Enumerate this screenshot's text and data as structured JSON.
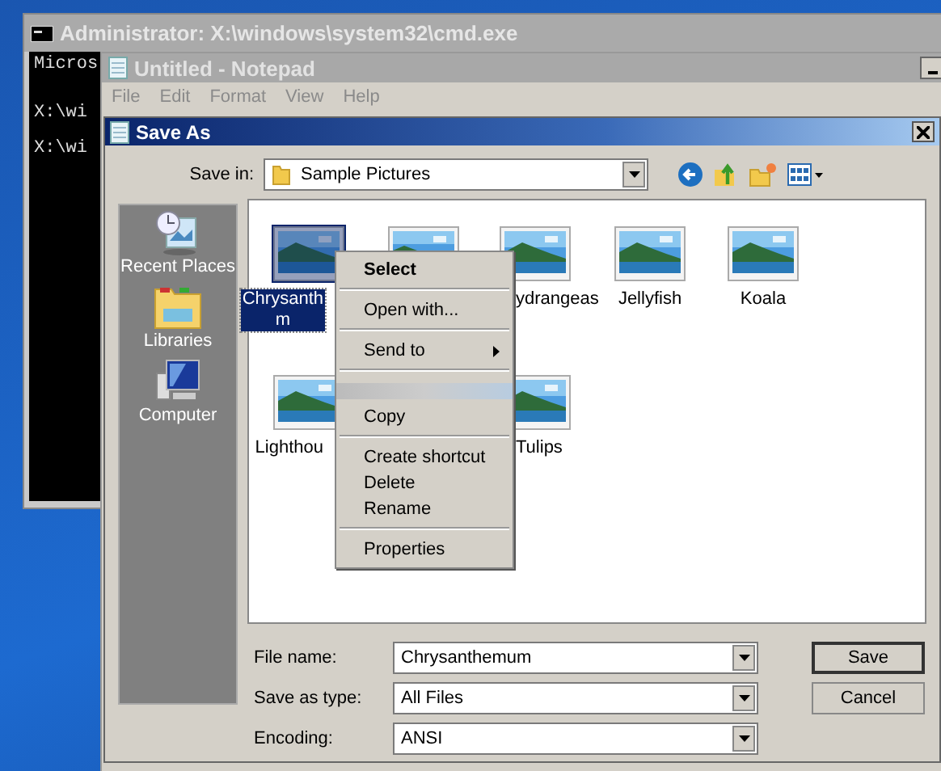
{
  "console_window": {
    "title": "Administrator: X:\\windows\\system32\\cmd.exe",
    "lines": [
      "Micros",
      "X:\\wi",
      "X:\\wi"
    ]
  },
  "notepad_window": {
    "title": "Untitled - Notepad",
    "menu": [
      "File",
      "Edit",
      "Format",
      "View",
      "Help"
    ]
  },
  "save_dialog": {
    "title": "Save As",
    "save_in": {
      "label": "Save in:",
      "value": "Sample Pictures"
    },
    "places": [
      {
        "kind": "recent",
        "label": "Recent Places"
      },
      {
        "kind": "libraries",
        "label": "Libraries"
      },
      {
        "kind": "computer",
        "label": "Computer"
      }
    ],
    "files": [
      {
        "kind": "file",
        "label_lines": [
          "Chrysanth",
          "m"
        ],
        "selected": true
      },
      {
        "kind": "partial",
        "selected": false
      },
      {
        "kind": "file",
        "label_lines": [
          "ydrangeas"
        ],
        "selected": false
      },
      {
        "kind": "file",
        "label_lines": [
          "Jellyfish"
        ],
        "selected": false
      },
      {
        "kind": "file",
        "label_lines": [
          "Koala"
        ],
        "selected": false
      },
      {
        "kind": "file",
        "label_lines": [
          "Lighthou"
        ],
        "selected": false
      },
      {
        "kind": "covered"
      },
      {
        "kind": "file",
        "label_lines": [
          "Tulips"
        ],
        "selected": false
      }
    ],
    "fields": [
      {
        "label": "File name:",
        "value": "Chrysanthemum"
      },
      {
        "label": "Save as type:",
        "value": "All Files"
      },
      {
        "label": "Encoding:",
        "value": "ANSI"
      }
    ],
    "buttons": [
      {
        "label": "Save",
        "default": true
      },
      {
        "label": "Cancel",
        "default": false
      }
    ]
  },
  "context_menu": [
    {
      "kind": "item",
      "label": "Select",
      "default": true,
      "submenu": false
    },
    {
      "kind": "separator"
    },
    {
      "kind": "item",
      "label": "Open with...",
      "default": false,
      "submenu": false
    },
    {
      "kind": "separator"
    },
    {
      "kind": "item",
      "label": "Send to",
      "default": false,
      "submenu": true
    },
    {
      "kind": "separator"
    },
    {
      "kind": "blurred"
    },
    {
      "kind": "item",
      "label": "Copy",
      "default": false,
      "submenu": false
    },
    {
      "kind": "separator"
    },
    {
      "kind": "item",
      "label": "Create shortcut",
      "default": false,
      "submenu": false
    },
    {
      "kind": "item",
      "label": "Delete",
      "default": false,
      "submenu": false
    },
    {
      "kind": "item",
      "label": "Rename",
      "default": false,
      "submenu": false
    },
    {
      "kind": "separator"
    },
    {
      "kind": "item",
      "label": "Properties",
      "default": false,
      "submenu": false
    }
  ]
}
